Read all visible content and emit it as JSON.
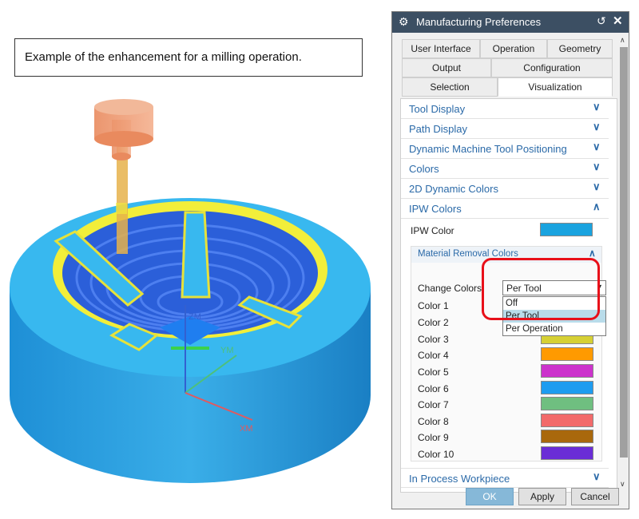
{
  "caption": "Example of the enhancement for a milling operation.",
  "illustration": {
    "axis_z": "ZM",
    "axis_y": "YM",
    "axis_x": "XM"
  },
  "dialog": {
    "title": "Manufacturing Preferences",
    "tabs": [
      "User Interface",
      "Operation",
      "Geometry",
      "Output",
      "Configuration",
      "Selection",
      "Visualization"
    ],
    "active_tab": "Visualization",
    "sections": [
      {
        "label": "Tool Display",
        "expanded": false
      },
      {
        "label": "Path Display",
        "expanded": false
      },
      {
        "label": "Dynamic Machine Tool Positioning",
        "expanded": false
      },
      {
        "label": "Colors",
        "expanded": false
      },
      {
        "label": "2D Dynamic Colors",
        "expanded": false
      },
      {
        "label": "IPW Colors",
        "expanded": true
      }
    ],
    "ipw_color_label": "IPW Color",
    "ipw_color": "#1aa3df",
    "material_removal": {
      "title": "Material Removal Colors",
      "change_colors_label": "Change Colors",
      "change_colors_value": "Per Tool",
      "options": [
        "Off",
        "Per Tool",
        "Per Operation"
      ],
      "selected_option": "Per Tool",
      "colors": [
        {
          "label": "Color 1",
          "hex": "#2255dd"
        },
        {
          "label": "Color 2",
          "hex": "#33aa44"
        },
        {
          "label": "Color 3",
          "hex": "#d6d034"
        },
        {
          "label": "Color 4",
          "hex": "#ff9a00"
        },
        {
          "label": "Color 5",
          "hex": "#cc33cc"
        },
        {
          "label": "Color 6",
          "hex": "#1e9cf0"
        },
        {
          "label": "Color 7",
          "hex": "#6fbf80"
        },
        {
          "label": "Color 8",
          "hex": "#f26a6a"
        },
        {
          "label": "Color 9",
          "hex": "#a9680c"
        },
        {
          "label": "Color 10",
          "hex": "#6a2dd6"
        }
      ]
    },
    "bottom_section": "In Process Workpiece",
    "buttons": {
      "ok": "OK",
      "apply": "Apply",
      "cancel": "Cancel"
    }
  }
}
